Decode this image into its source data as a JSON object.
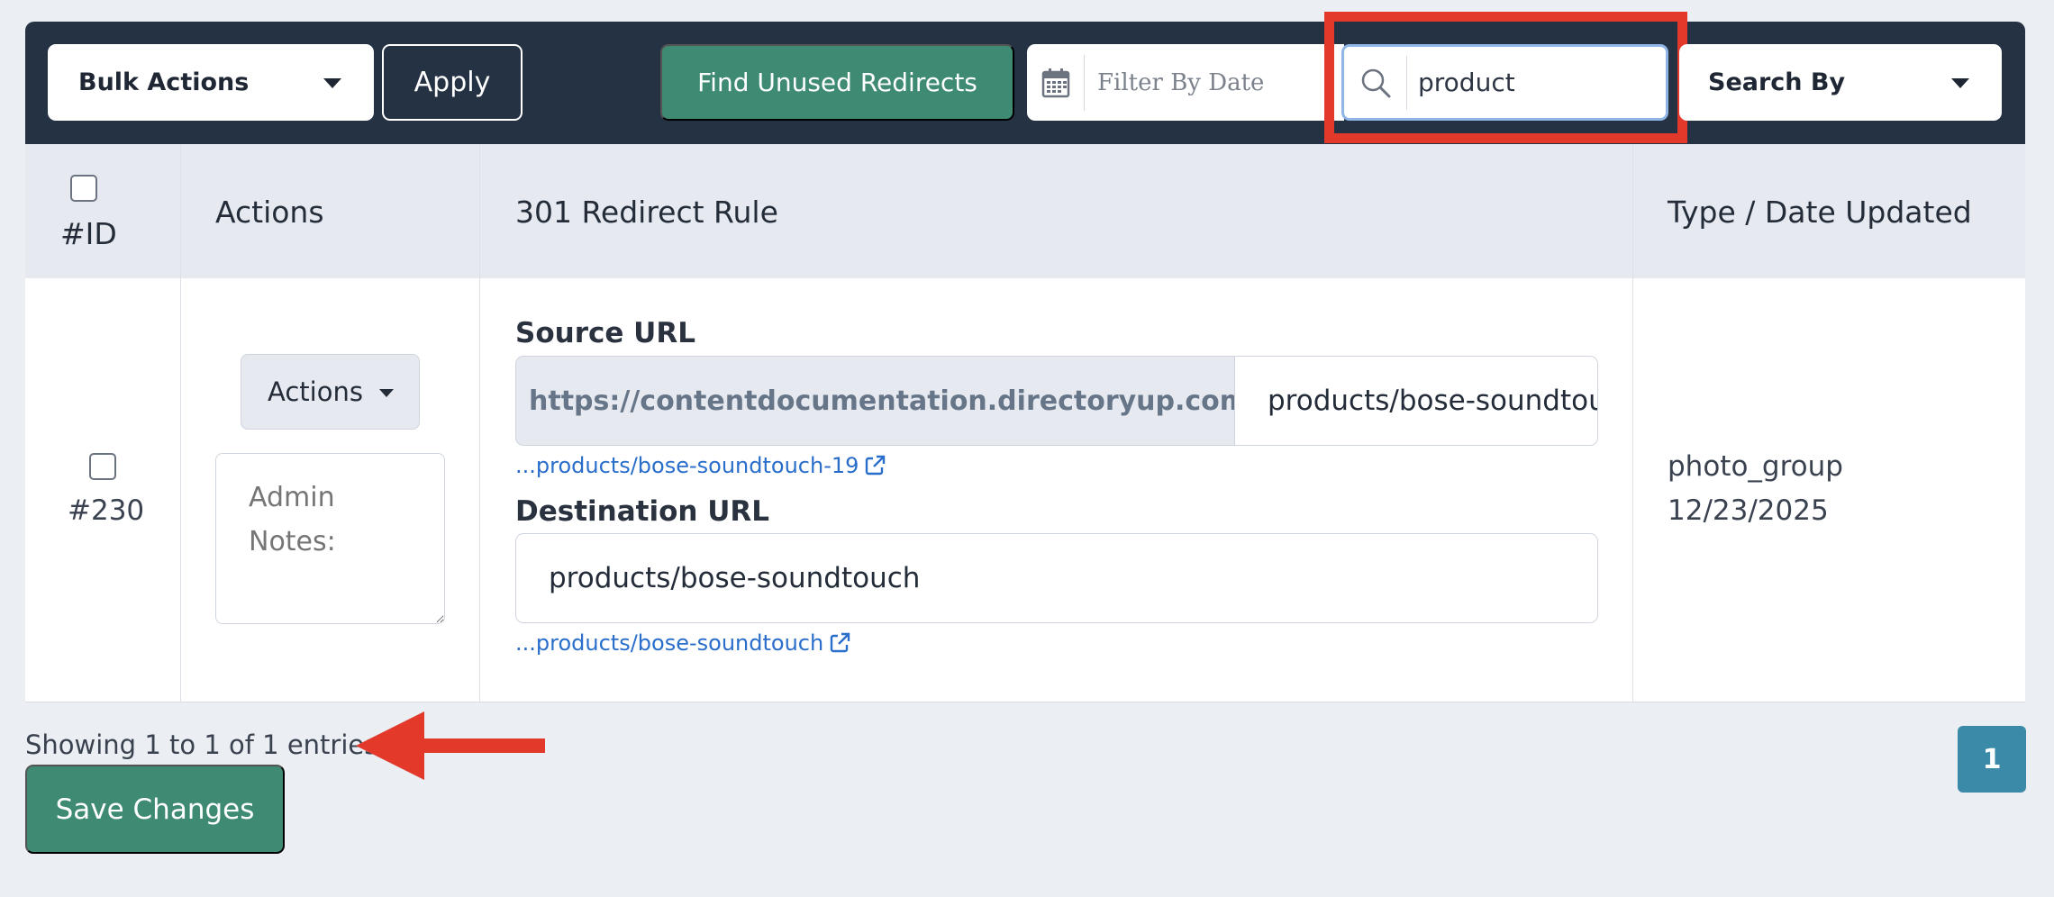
{
  "toolbar": {
    "bulk_actions_label": "Bulk Actions",
    "apply_label": "Apply",
    "find_unused_label": "Find Unused Redirects",
    "date_filter_placeholder": "Filter By Date",
    "search_value": "product",
    "search_by_label": "Search By"
  },
  "table": {
    "headers": {
      "id": "#ID",
      "actions": "Actions",
      "rule": "301 Redirect Rule",
      "type_date": "Type / Date Updated"
    },
    "rows": [
      {
        "id": "#230",
        "actions_label": "Actions",
        "notes_placeholder": "Admin Notes:",
        "source_label": "Source URL",
        "source_prefix": "https://contentdocumentation.directoryup.com/",
        "source_value": "products/bose-soundtouch-19",
        "source_link": "...products/bose-soundtouch-19",
        "destination_label": "Destination URL",
        "destination_value": "products/bose-soundtouch",
        "destination_link": "...products/bose-soundtouch",
        "type": "photo_group",
        "date_updated": "12/23/2025"
      }
    ]
  },
  "footer": {
    "showing_text": "Showing 1 to 1 of 1 entries",
    "save_label": "Save Changes",
    "current_page": "1"
  },
  "colors": {
    "toolbar_bg": "#253244",
    "accent_green": "#3e8a72",
    "highlight_red": "#e3392b",
    "link_blue": "#2a6ecb",
    "pagination_blue": "#3a8aa8"
  },
  "icons": {
    "calendar": "calendar-icon",
    "search": "search-icon",
    "external_link": "external-link-icon",
    "annotation_arrow": "arrow-left-icon"
  }
}
